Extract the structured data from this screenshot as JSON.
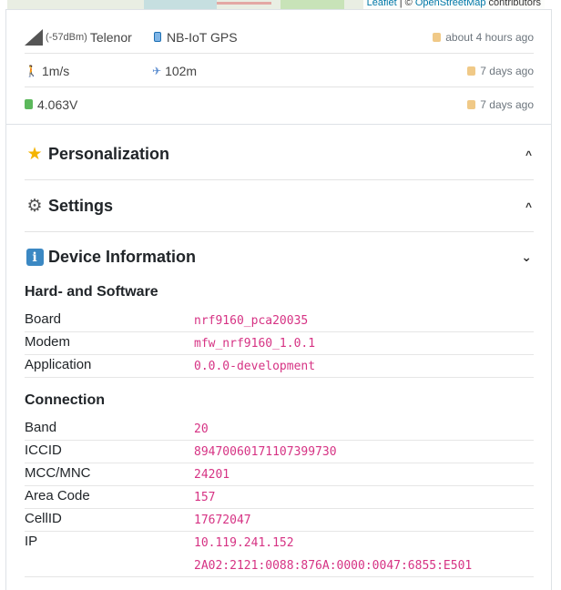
{
  "map": {
    "attribution_leaflet": "Leaflet",
    "attribution_sep": " | © ",
    "attribution_osm": "OpenStreetMap",
    "attribution_suffix": " contributors"
  },
  "status": {
    "signal_dbm": "(-57dBm)",
    "operator": "Telenor",
    "network_mode": "NB-IoT GPS",
    "network_time": "about 4 hours ago",
    "speed": "1m/s",
    "altitude": "102m",
    "gps_time": "7 days ago",
    "voltage": "4.063V",
    "battery_time": "7 days ago"
  },
  "accordions": {
    "personalization": {
      "label": "Personalization",
      "chevron": "^"
    },
    "settings": {
      "label": "Settings",
      "chevron": "^"
    },
    "device_info": {
      "label": "Device Information",
      "chevron": "⌄"
    }
  },
  "hardware": {
    "title": "Hard- and Software",
    "rows": [
      {
        "key": "Board",
        "value": "nrf9160_pca20035"
      },
      {
        "key": "Modem",
        "value": "mfw_nrf9160_1.0.1"
      },
      {
        "key": "Application",
        "value": "0.0.0-development"
      }
    ]
  },
  "connection": {
    "title": "Connection",
    "rows": [
      {
        "key": "Band",
        "value": "20"
      },
      {
        "key": "ICCID",
        "value": "89470060171107399730"
      },
      {
        "key": "MCC/MNC",
        "value": "24201"
      },
      {
        "key": "Area Code",
        "value": "157"
      },
      {
        "key": "CellID",
        "value": "17672047"
      },
      {
        "key": "IP",
        "value": "10.119.241.152"
      },
      {
        "key": "",
        "value": "2A02:2121:0088:876A:0000:0047:6855:E501"
      }
    ]
  }
}
